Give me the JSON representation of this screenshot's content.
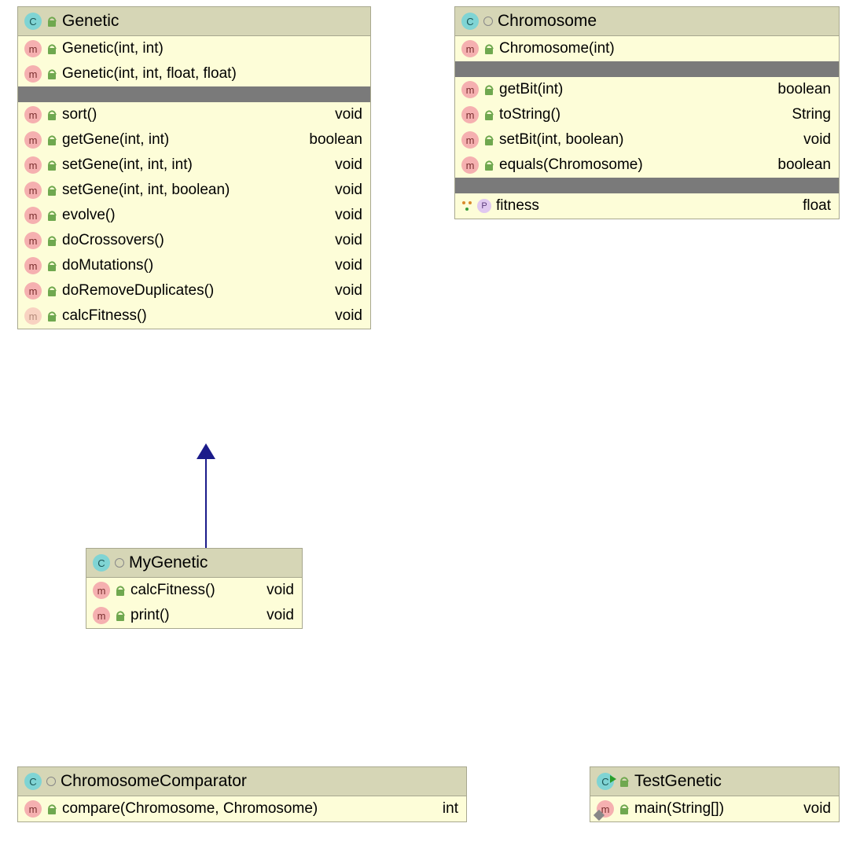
{
  "classes": {
    "genetic": {
      "name": "Genetic",
      "kind": "class",
      "visibility": "public",
      "constructors": [
        {
          "sig": "Genetic(int, int)"
        },
        {
          "sig": "Genetic(int, int, float, float)"
        }
      ],
      "methods": [
        {
          "sig": "sort()",
          "ret": "void",
          "abstract": false
        },
        {
          "sig": "getGene(int, int)",
          "ret": "boolean",
          "abstract": false
        },
        {
          "sig": "setGene(int, int, int)",
          "ret": "void",
          "abstract": false
        },
        {
          "sig": "setGene(int, int, boolean)",
          "ret": "void",
          "abstract": false
        },
        {
          "sig": "evolve()",
          "ret": "void",
          "abstract": false
        },
        {
          "sig": "doCrossovers()",
          "ret": "void",
          "abstract": false
        },
        {
          "sig": "doMutations()",
          "ret": "void",
          "abstract": false
        },
        {
          "sig": "doRemoveDuplicates()",
          "ret": "void",
          "abstract": false
        },
        {
          "sig": "calcFitness()",
          "ret": "void",
          "abstract": true
        }
      ]
    },
    "chromosome": {
      "name": "Chromosome",
      "kind": "class",
      "visibility": "package",
      "constructors": [
        {
          "sig": "Chromosome(int)"
        }
      ],
      "methods": [
        {
          "sig": "getBit(int)",
          "ret": "boolean"
        },
        {
          "sig": "toString()",
          "ret": "String"
        },
        {
          "sig": "setBit(int, boolean)",
          "ret": "void"
        },
        {
          "sig": "equals(Chromosome)",
          "ret": "boolean"
        }
      ],
      "properties": [
        {
          "sig": "fitness",
          "ret": "float"
        }
      ]
    },
    "mygenetic": {
      "name": "MyGenetic",
      "kind": "class",
      "visibility": "package",
      "methods": [
        {
          "sig": "calcFitness()",
          "ret": "void"
        },
        {
          "sig": "print()",
          "ret": "void"
        }
      ]
    },
    "comparator": {
      "name": "ChromosomeComparator",
      "kind": "class",
      "visibility": "package",
      "methods": [
        {
          "sig": "compare(Chromosome, Chromosome)",
          "ret": "int"
        }
      ]
    },
    "testgenetic": {
      "name": "TestGenetic",
      "kind": "class",
      "visibility": "public",
      "runnable": true,
      "methods": [
        {
          "sig": "main(String[])",
          "ret": "void",
          "static": true
        }
      ]
    }
  }
}
